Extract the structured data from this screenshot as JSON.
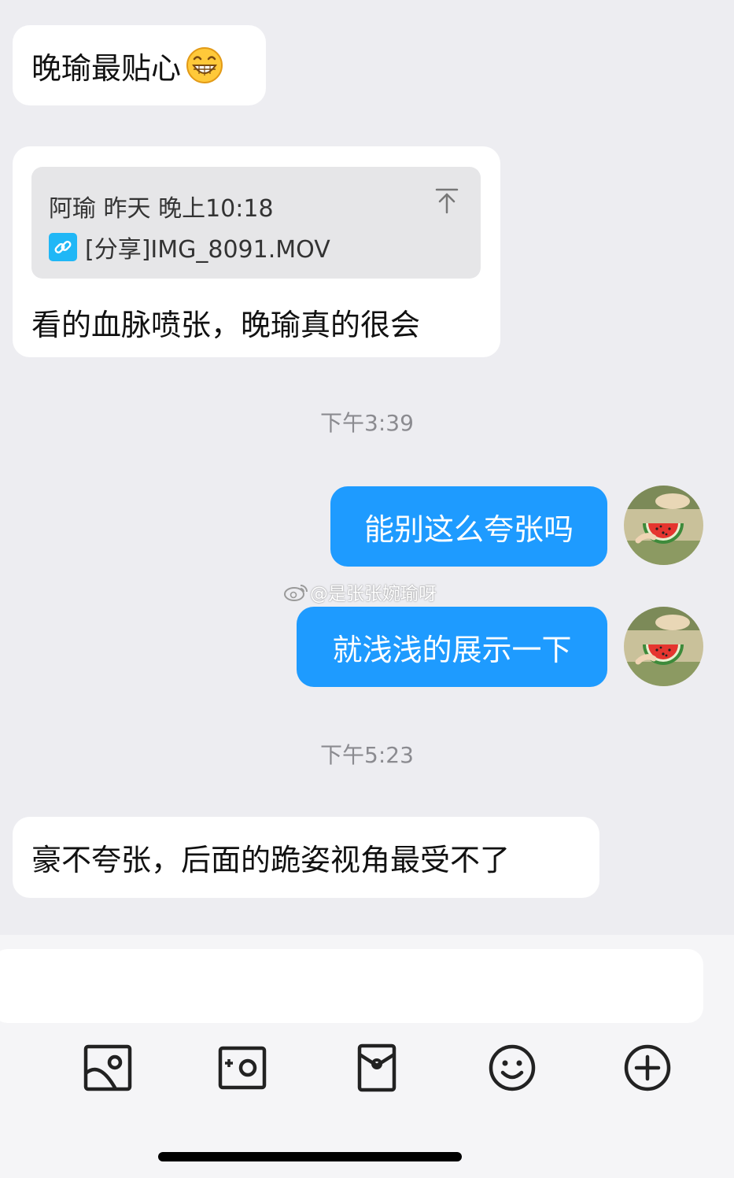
{
  "messages": {
    "m1": {
      "text": "晚瑜最贴心",
      "emoji": "grinning-face-emoji"
    },
    "m2": {
      "quote_header": "阿瑜 昨天 晚上10:18",
      "quote_file": "[分享]IMG_8091.MOV",
      "text": "看的血脉喷张，晚瑜真的很会"
    },
    "time1": "下午3:39",
    "m3": {
      "text": "能别这么夸张吗"
    },
    "m4": {
      "text": "就浅浅的展示一下"
    },
    "time2": "下午5:23",
    "m5": {
      "text": "豪不夸张，后面的跪姿视角最受不了"
    }
  },
  "watermark": "@是张张婉瑜呀",
  "toolbar": {
    "icons": [
      "image-icon",
      "camera-icon",
      "red-packet-icon",
      "emoji-icon",
      "plus-icon"
    ]
  },
  "colors": {
    "background": "#ededf1",
    "incoming_bubble": "#ffffff",
    "outgoing_bubble": "#1e9bff",
    "timestamp": "#8b8b90"
  }
}
